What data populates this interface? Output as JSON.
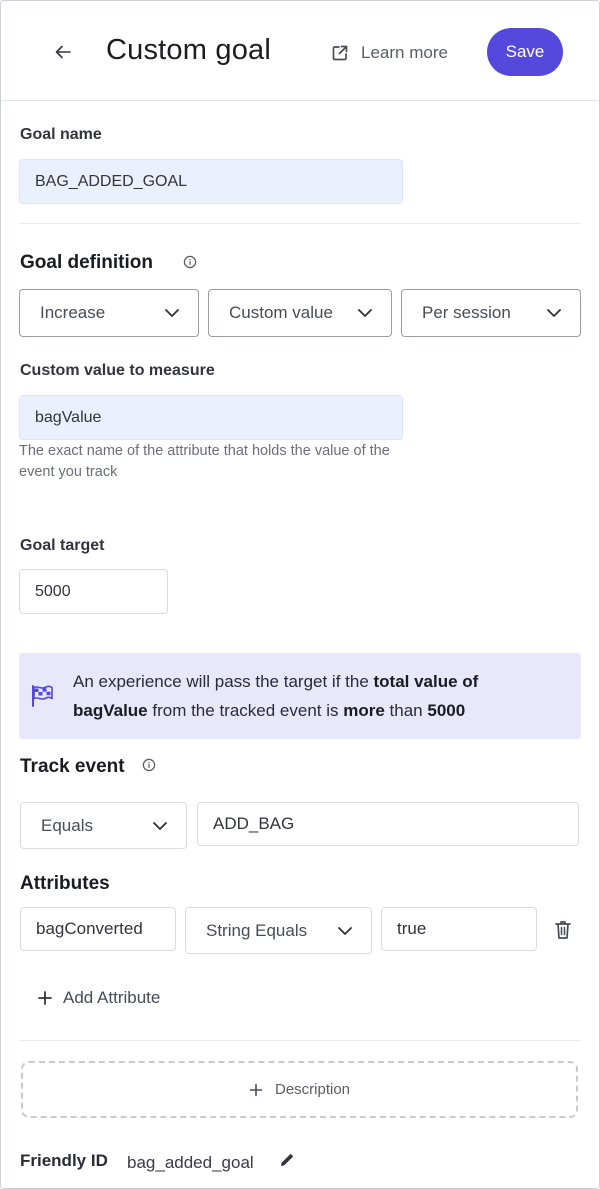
{
  "header": {
    "title": "Custom goal",
    "learn_more": "Learn more",
    "save": "Save"
  },
  "goal_name": {
    "label": "Goal name",
    "value": "BAG_ADDED_GOAL"
  },
  "goal_definition": {
    "heading": "Goal definition",
    "direction": "Increase",
    "metric": "Custom value",
    "scope": "Per session"
  },
  "custom_value": {
    "label": "Custom value to measure",
    "value": "bagValue",
    "help": "The exact name of the attribute that holds the value of the event you track"
  },
  "goal_target": {
    "label": "Goal target",
    "value": "5000"
  },
  "summary": {
    "part1": "An experience will pass the target if the ",
    "bold1": "total value of bagValue",
    "part2": " from the tracked event is ",
    "bold2": "more",
    "part3": " than ",
    "bold3": "5000"
  },
  "track_event": {
    "heading": "Track event",
    "operator": "Equals",
    "value": "ADD_BAG"
  },
  "attributes": {
    "heading": "Attributes",
    "rows": [
      {
        "name": "bagConverted",
        "operator": "String Equals",
        "value": "true"
      }
    ],
    "add_label": "Add Attribute"
  },
  "description": {
    "label": "Description"
  },
  "friendly_id": {
    "label": "Friendly ID",
    "value": "bag_added_goal"
  },
  "colors": {
    "accent": "#5548dc",
    "filled_input": "#eaf0fc",
    "banner": "#e7e8fb"
  },
  "icons": {
    "back": "arrow-left-icon",
    "learn_more": "external-link-icon",
    "info": "info-icon",
    "flag": "checkered-flag-icon",
    "chevron": "chevron-down-icon",
    "trash": "trash-icon",
    "plus": "plus-icon",
    "pencil": "pencil-icon"
  }
}
